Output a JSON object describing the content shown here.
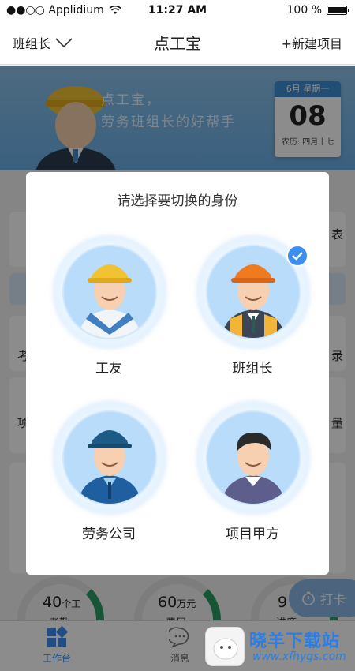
{
  "status_bar": {
    "carrier": "●●○○ Applidium",
    "time": "11:27 AM",
    "battery": "100 %"
  },
  "nav": {
    "role_selector": "班组长",
    "title": "点工宝",
    "new_project": "+新建项目"
  },
  "banner": {
    "slogan_line1": "点工宝，",
    "slogan_line2": "劳务班组长的好帮手",
    "calendar": {
      "header": "6月 星期一",
      "day": "08",
      "lunar": "农历: 四月十七"
    }
  },
  "background": {
    "side_labels": [
      "表",
      "考",
      "录",
      "项",
      "量"
    ],
    "gauges": [
      {
        "value": "40",
        "unit": "个工",
        "label": "考勤"
      },
      {
        "value": "60",
        "unit": "万元",
        "label": "费用"
      },
      {
        "value": "9",
        "unit": "",
        "label": "进度"
      }
    ],
    "checkin": "打卡"
  },
  "tab_bar": {
    "tabs": [
      {
        "label": "工作台"
      },
      {
        "label": "消息"
      }
    ]
  },
  "dialog": {
    "title": "请选择要切换的身份",
    "roles": [
      {
        "label": "工友",
        "selected": false
      },
      {
        "label": "班组长",
        "selected": true
      },
      {
        "label": "劳务公司",
        "selected": false
      },
      {
        "label": "项目甲方",
        "selected": false
      }
    ]
  },
  "watermark": {
    "title": "晓羊下载站",
    "subtitle": "www.xfhygs.com"
  },
  "colors": {
    "accent": "#3b8ff0",
    "banner": "#6aaee6",
    "gauge": "#2a9b64",
    "overlay": "rgba(0,0,0,0.45)"
  }
}
